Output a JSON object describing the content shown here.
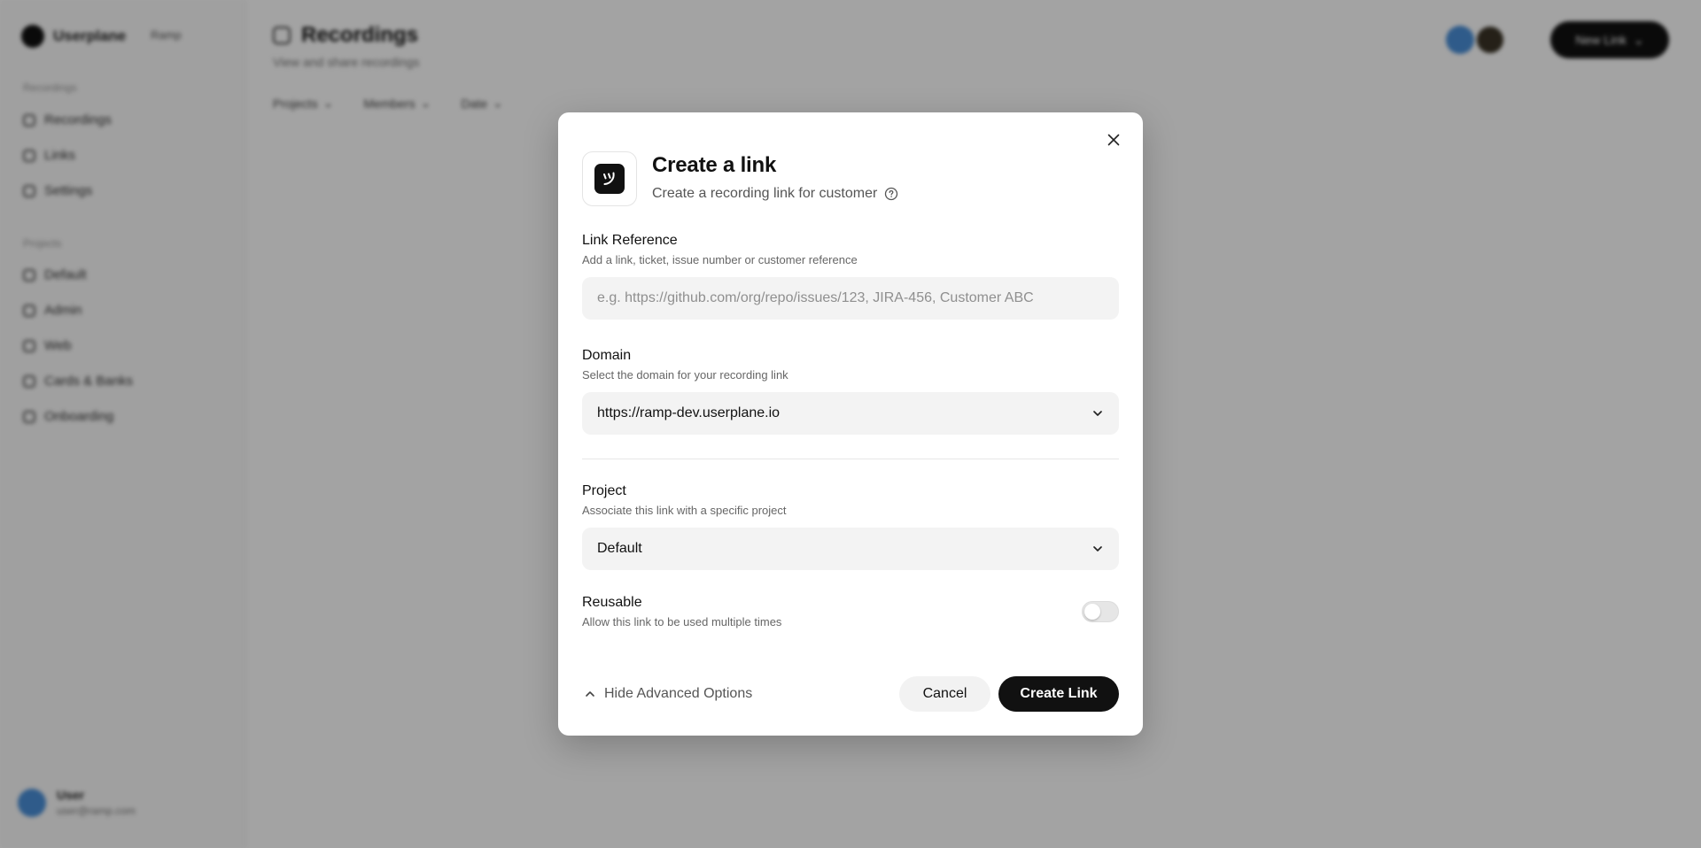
{
  "background": {
    "brand": "Userplane",
    "workspace": "Ramp",
    "sidebar": {
      "groups": [
        {
          "label": "Recordings",
          "items": [
            "Recordings",
            "Links",
            "Settings"
          ]
        },
        {
          "label": "Projects",
          "items": [
            "Default",
            "Admin",
            "Web",
            "Cards & Banks",
            "Onboarding"
          ]
        }
      ]
    },
    "page_title": "Recordings",
    "page_subtitle": "View and share recordings",
    "filters": [
      "Projects",
      "Members",
      "Date"
    ],
    "new_button": "New Link",
    "user": {
      "name": "User",
      "email": "user@ramp.com"
    }
  },
  "modal": {
    "title": "Create a link",
    "subtitle": "Create a recording link for customer",
    "link_reference": {
      "label": "Link Reference",
      "description": "Add a link, ticket, issue number or customer reference",
      "placeholder": "e.g. https://github.com/org/repo/issues/123, JIRA-456, Customer ABC",
      "value": ""
    },
    "domain": {
      "label": "Domain",
      "description": "Select the domain for your recording link",
      "selected": "https://ramp-dev.userplane.io"
    },
    "project": {
      "label": "Project",
      "description": "Associate this link with a specific project",
      "selected": "Default"
    },
    "reusable": {
      "label": "Reusable",
      "description": "Allow this link to be used multiple times",
      "enabled": false
    },
    "advanced_toggle": "Hide Advanced Options",
    "cancel_label": "Cancel",
    "create_label": "Create Link"
  },
  "colors": {
    "primary": "#111111",
    "input_bg": "#f3f3f3",
    "overlay": "rgba(0,0,0,0.36)"
  },
  "icons": {
    "close": "close-icon",
    "help": "help-circle-icon",
    "chevron": "chevron-down-icon",
    "collapse": "chevron-up-icon",
    "app": "userplane-logo-icon"
  }
}
